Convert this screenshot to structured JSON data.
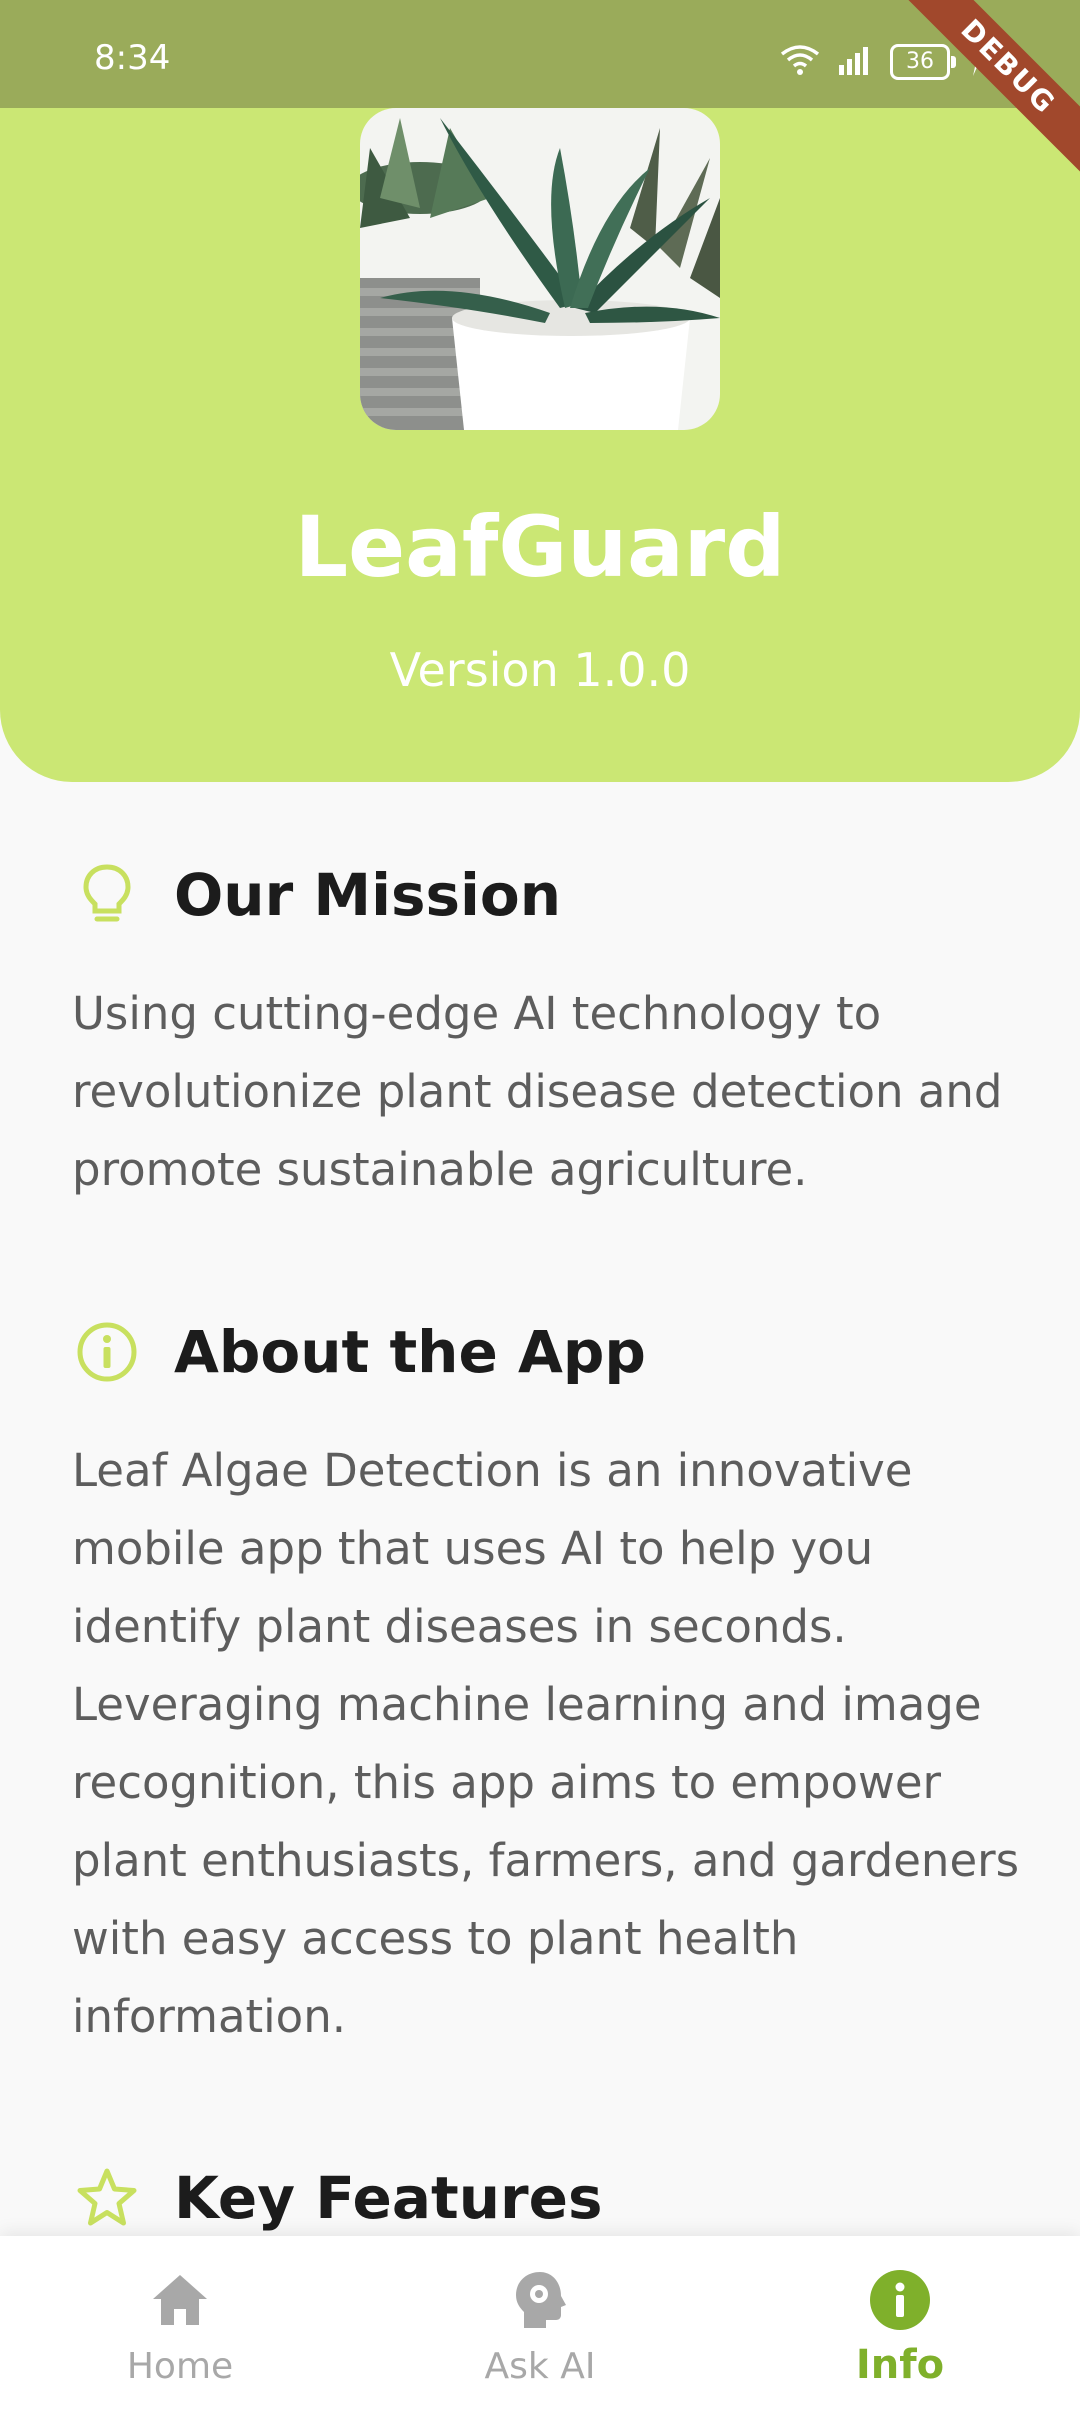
{
  "status_bar": {
    "time": "8:34",
    "battery": "36",
    "debug_label": "DEBUG"
  },
  "header": {
    "title": "LeafGuard",
    "version": "Version 1.0.0"
  },
  "sections": {
    "mission": {
      "icon": "lightbulb-icon",
      "title": "Our Mission",
      "body": "Using cutting-edge AI technology to revolutionize plant disease detection and promote sustainable agriculture."
    },
    "about": {
      "icon": "info-circle-icon",
      "title": "About the App",
      "body": "Leaf Algae Detection is an innovative mobile app that uses AI to help you identify plant diseases in seconds. Leveraging machine learning and image recognition, this app aims to empower plant enthusiasts, farmers, and gardeners with easy access to plant health information."
    },
    "features": {
      "icon": "star-icon",
      "title": "Key Features"
    }
  },
  "bottom_nav": {
    "items": [
      {
        "label": "Home",
        "icon": "home-icon",
        "active": false
      },
      {
        "label": "Ask AI",
        "icon": "ai-head-icon",
        "active": false
      },
      {
        "label": "Info",
        "icon": "info-icon",
        "active": true
      }
    ]
  },
  "colors": {
    "status_bar": "#9aab5a",
    "header": "#cbe774",
    "accent": "#7fb02b",
    "icon_accent": "#c8e05f",
    "debug_ribbon": "#a1482c"
  }
}
